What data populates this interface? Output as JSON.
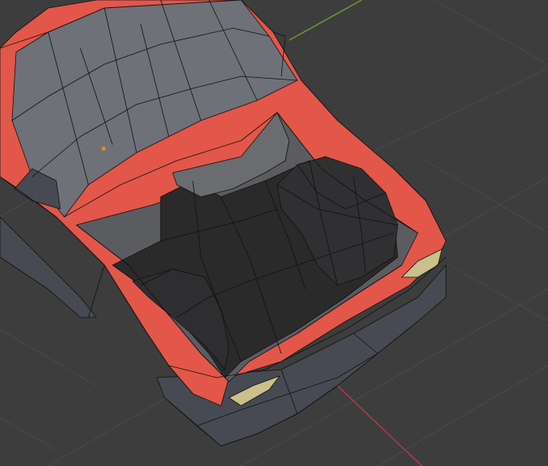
{
  "viewport": {
    "view_kind": "3d-viewport-mesh-wireframe",
    "background_color": "#3d3d3d",
    "grid_color": "#4a4a4a",
    "y_axis_color": "#6a9a2a",
    "x_axis_color": "#b03a46",
    "mesh_body_color": "#e2574a",
    "mesh_interior_dark": "#2a2a2a",
    "mesh_glass_color": "#6f7178",
    "mesh_bumper_color": "#474a52",
    "wire_color": "#111111",
    "origin_point_color": "#f08a1a"
  }
}
